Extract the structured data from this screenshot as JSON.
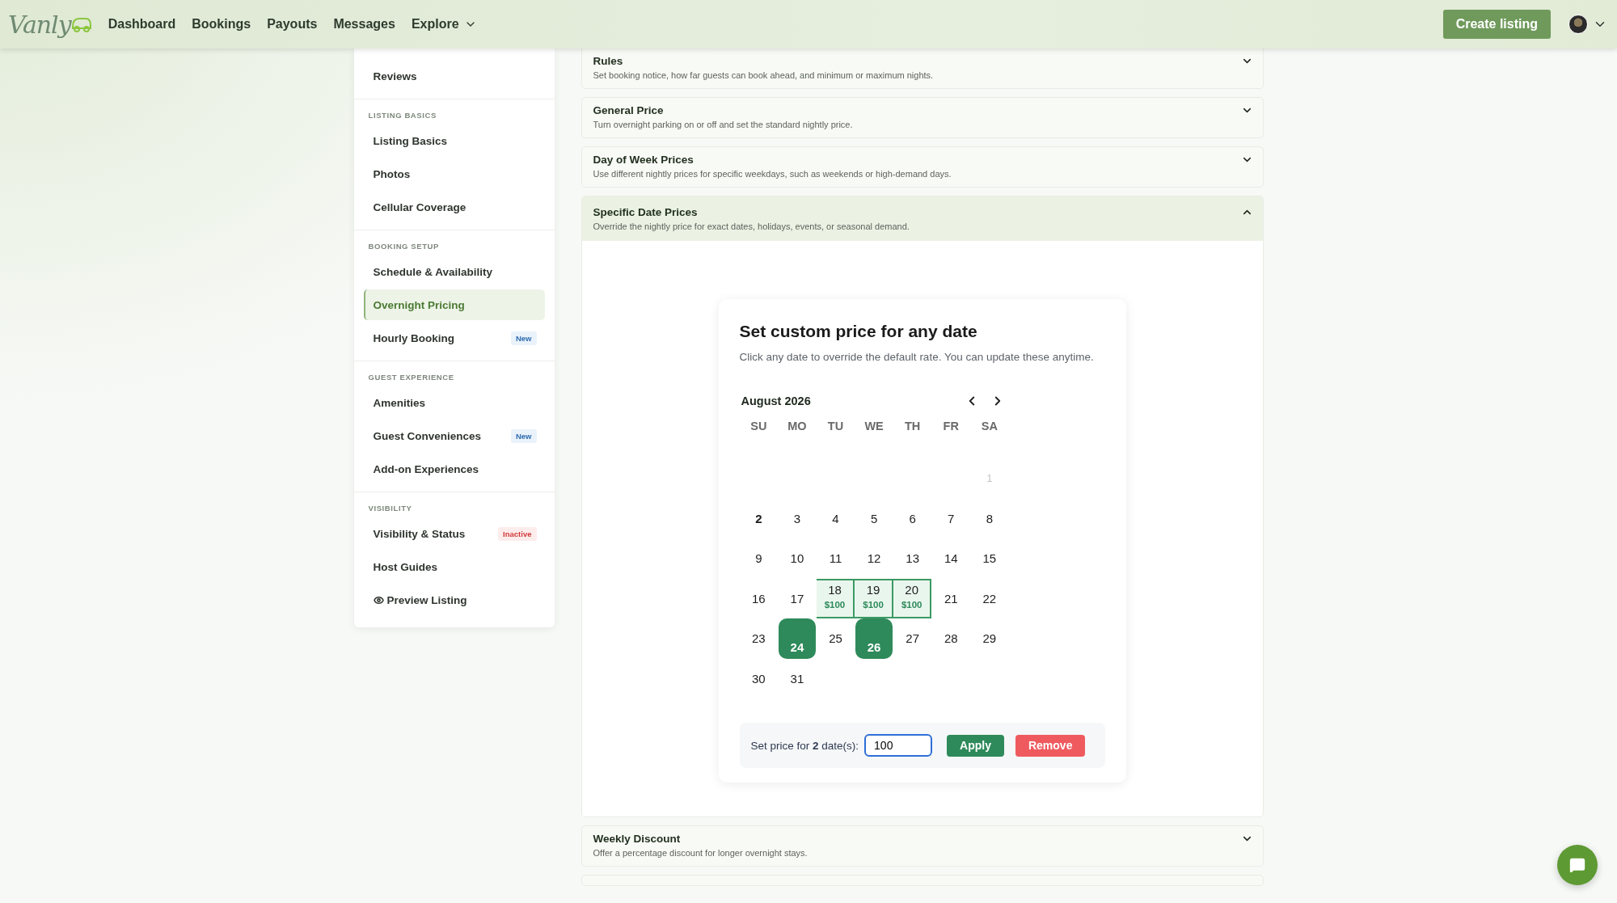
{
  "header": {
    "logo": "Vanly",
    "nav": [
      {
        "label": "Dashboard",
        "dropdown": false
      },
      {
        "label": "Bookings",
        "dropdown": false
      },
      {
        "label": "Payouts",
        "dropdown": false
      },
      {
        "label": "Messages",
        "dropdown": false
      },
      {
        "label": "Explore",
        "dropdown": true
      }
    ],
    "create_button": "Create listing"
  },
  "sidebar": {
    "sections": [
      {
        "items": [
          {
            "label": "Reviews",
            "selected": false
          }
        ]
      },
      {
        "heading": "LISTING BASICS",
        "items": [
          {
            "label": "Listing Basics",
            "selected": false
          },
          {
            "label": "Photos",
            "selected": false
          },
          {
            "label": "Cellular Coverage",
            "selected": false
          }
        ]
      },
      {
        "heading": "BOOKING SETUP",
        "items": [
          {
            "label": "Schedule & Availability",
            "selected": false
          },
          {
            "label": "Overnight Pricing",
            "selected": true
          },
          {
            "label": "Hourly Booking",
            "selected": false,
            "badge": {
              "text": "New",
              "kind": "info"
            }
          }
        ]
      },
      {
        "heading": "GUEST EXPERIENCE",
        "items": [
          {
            "label": "Amenities",
            "selected": false
          },
          {
            "label": "Guest Conveniences",
            "selected": false,
            "badge": {
              "text": "New",
              "kind": "info"
            }
          },
          {
            "label": "Add-on Experiences",
            "selected": false
          }
        ]
      },
      {
        "heading": "VISIBILITY",
        "items": [
          {
            "label": "Visibility & Status",
            "selected": false,
            "badge": {
              "text": "Inactive",
              "kind": "danger"
            }
          },
          {
            "label": "Host Guides",
            "selected": false
          },
          {
            "label": "Preview Listing",
            "kind": "preview"
          }
        ]
      }
    ]
  },
  "accordions": [
    {
      "kind": "full",
      "title": "Rules",
      "description": "Set booking notice, how far guests can book ahead, and minimum or maximum nights.",
      "expanded": false
    },
    {
      "kind": "full",
      "title": "General Price",
      "description": "Turn overnight parking on or off and set the standard nightly price.",
      "expanded": false
    },
    {
      "kind": "full",
      "title": "Day of Week Prices",
      "description": "Use different nightly prices for specific weekdays, such as weekends or high-demand days.",
      "expanded": false
    },
    {
      "kind": "full",
      "title": "Specific Date Prices",
      "description": "Override the nightly price for exact dates, holidays, events, or seasonal demand.",
      "expanded": true
    },
    {
      "kind": "full",
      "title": "Weekly Discount",
      "description": "Offer a percentage discount for longer overnight stays.",
      "expanded": false
    },
    {
      "kind": "edge"
    }
  ],
  "calendar": {
    "title": "Set custom price for any date",
    "subtitle": "Click any date to override the default rate. You can update these anytime.",
    "month": "August 2026",
    "weekdays": [
      "SU",
      "MO",
      "TU",
      "WE",
      "TH",
      "FR",
      "SA"
    ],
    "weeks": [
      [
        {
          "kind": "blank"
        },
        {
          "kind": "blank"
        },
        {
          "kind": "blank"
        },
        {
          "kind": "blank"
        },
        {
          "kind": "blank"
        },
        {
          "kind": "blank"
        },
        {
          "day": "1",
          "kind": "past",
          "selected": false
        }
      ],
      [
        {
          "day": "2",
          "kind": "today",
          "selected": false
        },
        {
          "day": "3",
          "kind": "plain",
          "selected": false
        },
        {
          "day": "4",
          "kind": "plain",
          "selected": false
        },
        {
          "day": "5",
          "kind": "plain",
          "selected": false
        },
        {
          "day": "6",
          "kind": "plain",
          "selected": false
        },
        {
          "day": "7",
          "kind": "plain",
          "selected": false
        },
        {
          "day": "8",
          "kind": "plain",
          "selected": false
        }
      ],
      [
        {
          "day": "9",
          "kind": "plain",
          "selected": false
        },
        {
          "day": "10",
          "kind": "plain",
          "selected": false
        },
        {
          "day": "11",
          "kind": "plain",
          "selected": false
        },
        {
          "day": "12",
          "kind": "plain",
          "selected": false
        },
        {
          "day": "13",
          "kind": "plain",
          "selected": false
        },
        {
          "day": "14",
          "kind": "plain",
          "selected": false
        },
        {
          "day": "15",
          "kind": "plain",
          "selected": false
        }
      ],
      [
        {
          "day": "16",
          "kind": "plain",
          "selected": false
        },
        {
          "day": "17",
          "kind": "plain",
          "selected": false
        },
        {
          "day": "18",
          "kind": "priced",
          "price": "$100",
          "selected": false
        },
        {
          "day": "19",
          "kind": "priced",
          "price": "$100",
          "selected": false
        },
        {
          "day": "20",
          "kind": "priced",
          "price": "$100",
          "selected": false
        },
        {
          "day": "21",
          "kind": "plain",
          "selected": false
        },
        {
          "day": "22",
          "kind": "plain",
          "selected": false
        }
      ],
      [
        {
          "day": "23",
          "kind": "plain",
          "selected": false
        },
        {
          "day": "24",
          "kind": "plain",
          "selected": true
        },
        {
          "day": "25",
          "kind": "plain",
          "selected": false
        },
        {
          "day": "26",
          "kind": "plain",
          "selected": true
        },
        {
          "day": "27",
          "kind": "plain",
          "selected": false
        },
        {
          "day": "28",
          "kind": "plain",
          "selected": false
        },
        {
          "day": "29",
          "kind": "plain",
          "selected": false
        }
      ],
      [
        {
          "day": "30",
          "kind": "plain",
          "selected": false
        },
        {
          "day": "31",
          "kind": "plain",
          "selected": false
        }
      ]
    ],
    "price_bar": {
      "label": "Set price for **2** date(s):",
      "value": "100",
      "apply": "Apply",
      "remove": "Remove"
    }
  }
}
